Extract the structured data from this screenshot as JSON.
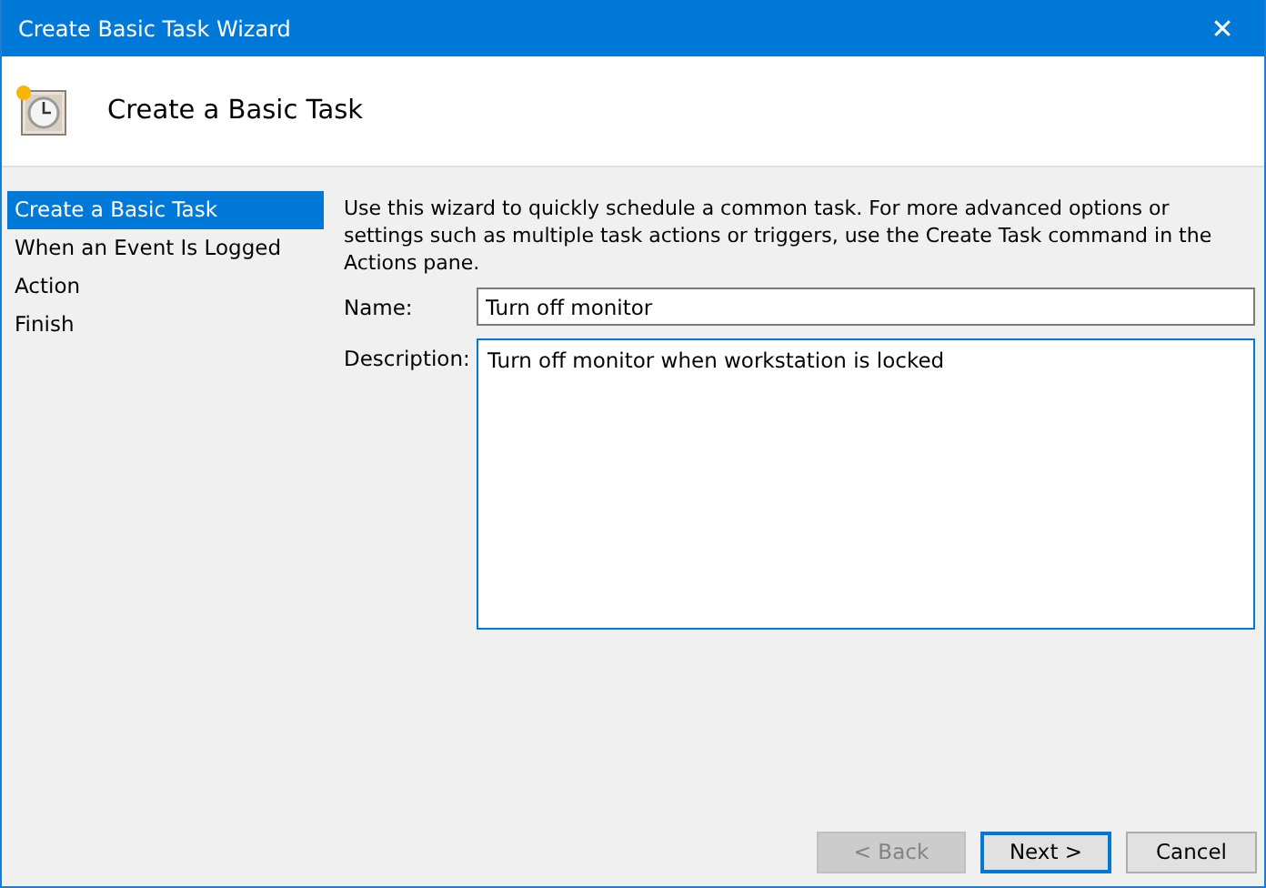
{
  "window": {
    "title": "Create Basic Task Wizard",
    "close_glyph": "✕"
  },
  "header": {
    "title": "Create a Basic Task"
  },
  "steps": [
    {
      "label": "Create a Basic Task",
      "selected": true
    },
    {
      "label": "When an Event Is Logged",
      "selected": false
    },
    {
      "label": "Action",
      "selected": false
    },
    {
      "label": "Finish",
      "selected": false
    }
  ],
  "intro": "Use this wizard to quickly schedule a common task.  For more advanced options or settings such as multiple task actions or triggers, use the Create Task command in the Actions pane.",
  "name_field": {
    "label": "Name:",
    "value": "Turn off monitor"
  },
  "description_field": {
    "label": "Description:",
    "value": "Turn off monitor when workstation is locked"
  },
  "buttons": [
    {
      "label": "< Back",
      "disabled": true,
      "default": false
    },
    {
      "label": "Next >",
      "disabled": false,
      "default": true
    },
    {
      "label": "Cancel",
      "disabled": false,
      "default": false
    }
  ]
}
